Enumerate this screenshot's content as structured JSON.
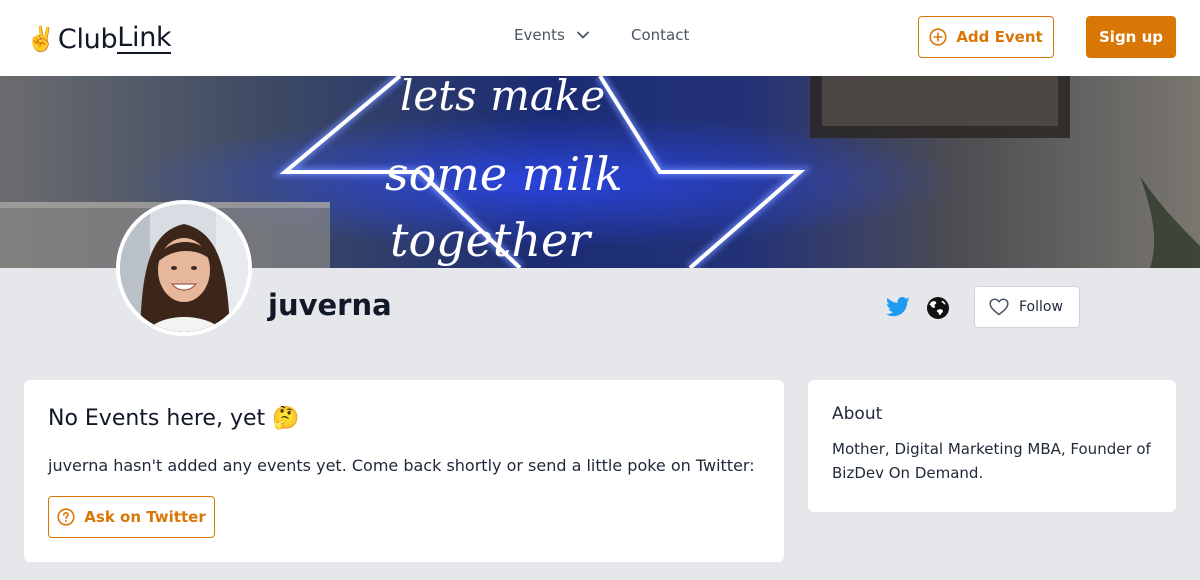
{
  "header": {
    "logo_hand": "✌️",
    "logo_club": "Club",
    "logo_link": "Link",
    "nav_events": "Events",
    "nav_contact": "Contact",
    "add_event_label": "Add Event",
    "signup_label": "Sign up"
  },
  "banner": {
    "line1": "lets make",
    "line2": "some milk",
    "line3": "together"
  },
  "profile": {
    "username": "juverna",
    "follow_label": "Follow"
  },
  "events": {
    "title": "No Events here, yet 🤔",
    "description": "juverna hasn't added any events yet. Come back shortly or send a little poke on Twitter:",
    "ask_label": "Ask on Twitter"
  },
  "about": {
    "title": "About",
    "text": "Mother, Digital Marketing MBA, Founder of BizDev On Demand."
  },
  "colors": {
    "accent": "#d97706",
    "twitter": "#1d9bf0",
    "page_bg": "#e5e7eb"
  },
  "icons": {
    "add": "plus-circle-icon",
    "events_dropdown": "chevron-down-icon",
    "twitter": "twitter-icon",
    "website": "globe-icon",
    "follow": "heart-icon",
    "ask": "question-circle-icon"
  }
}
